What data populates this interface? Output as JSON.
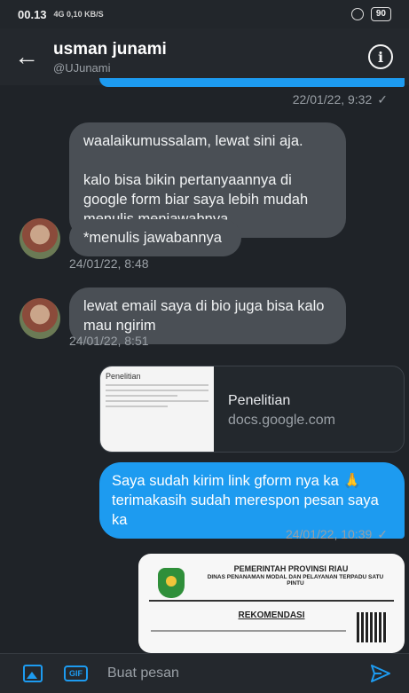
{
  "status_bar": {
    "time": "00.13",
    "signal": "4G 0,10 KB/S",
    "battery": "90"
  },
  "header": {
    "name": "usman junami",
    "handle": "@UJunami"
  },
  "messages": {
    "ts_sent_1": "22/01/22, 9:32",
    "received_1": "waalaikumussalam, lewat sini aja.\n\nkalo bisa bikin pertanyaannya di google form biar saya lebih mudah menulis menjawabnya.",
    "received_2": "*menulis jawabannya",
    "ts_received_1": "24/01/22, 8:48",
    "received_3": "lewat email saya di bio juga bisa kalo mau ngirim",
    "ts_received_2": "24/01/22, 8:51",
    "link_card": {
      "title": "Penelitian",
      "domain": "docs.google.com",
      "thumb_title": "Penelitian"
    },
    "sent_2": "Saya sudah kirim link gform nya ka 🙏 terimakasih sudah merespon pesan saya ka",
    "ts_sent_2": "24/01/22, 10:39",
    "document": {
      "line1": "PEMERINTAH PROVINSI RIAU",
      "line2": "DINAS PENANAMAN MODAL DAN PELAYANAN TERPADU SATU PINTU",
      "heading": "REKOMENDASI"
    }
  },
  "compose": {
    "placeholder": "Buat pesan",
    "gif_label": "GIF"
  },
  "colors": {
    "accent": "#1d9bf0",
    "background": "#1f2328",
    "bubble_in": "#4a4f55"
  },
  "icons": [
    "back-arrow-icon",
    "info-icon",
    "image-icon",
    "gif-icon",
    "send-icon",
    "checkmark-icon"
  ]
}
